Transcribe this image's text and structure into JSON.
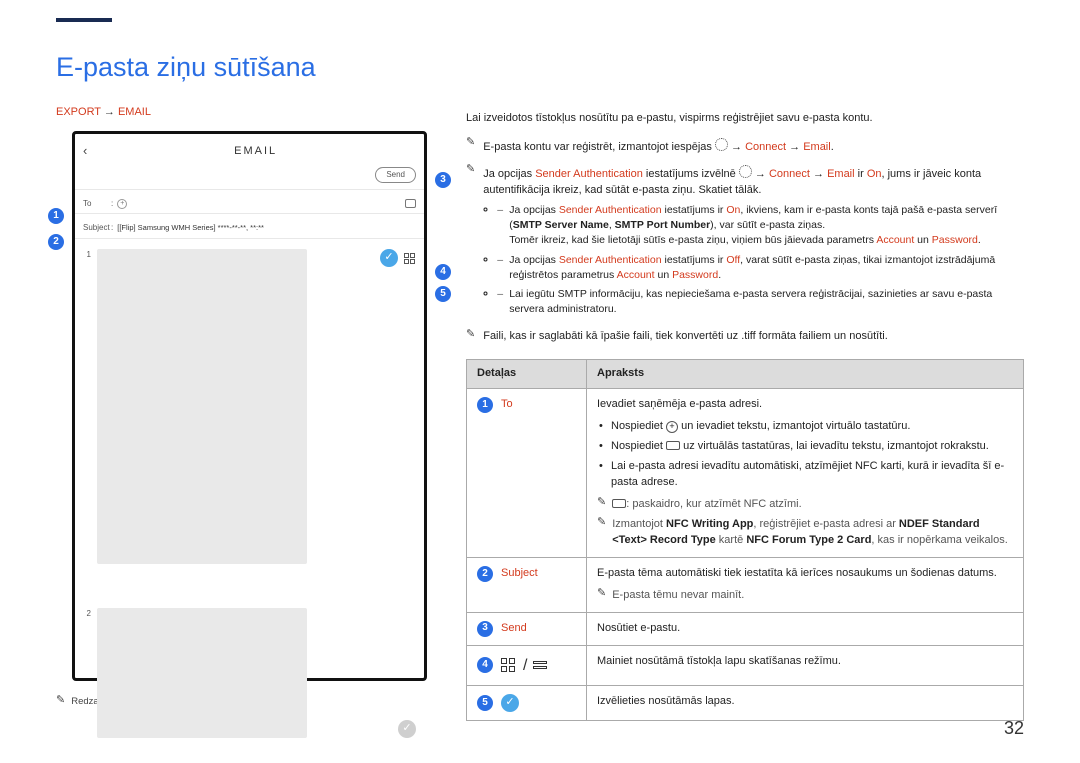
{
  "page_title": "E-pasta ziņu sūtīšana",
  "page_number": "32",
  "breadcrumb": {
    "a": "EXPORT",
    "arrow": "→",
    "b": "EMAIL"
  },
  "image_footnote": "Redzamais attēls var būt atšķirīgs atkarībā no modeļa.",
  "device": {
    "title": "EMAIL",
    "send": "Send",
    "to_label": "To",
    "plus": "+",
    "subject_label": "Subject",
    "subject_value": "[[Flip] Samsung WMH Series] ****-**-**, **:**",
    "page1": "1",
    "page2": "2"
  },
  "intro": "Lai izveidotos tīstokļus nosūtītu pa e-pastu, vispirms reģistrējiet savu e-pasta kontu.",
  "bul1_a": "E-pasta kontu var reģistrēt, izmantojot iespējas ",
  "bul1_b": " → ",
  "bul1_c": "Connect",
  "bul1_d": " → ",
  "bul1_e": "Email",
  "bul1_f": ".",
  "bul2_a": "Ja opcijas ",
  "bul2_b": "Sender Authentication",
  "bul2_c": " iestatījums izvēlnē ",
  "bul2_d": " → ",
  "bul2_e": "Connect",
  "bul2_f": " → ",
  "bul2_g": "Email",
  "bul2_h": " ir ",
  "bul2_i": "On",
  "bul2_j": ", jums ir jāveic konta autentifikācija ikreiz, kad sūtāt e-pasta ziņu. Skatiet tālāk.",
  "sub1_a": "Ja opcijas ",
  "sub1_b": "Sender Authentication",
  "sub1_c": " iestatījums ir ",
  "sub1_d": "On",
  "sub1_e": ", ikviens, kam ir e-pasta konts tajā pašā e-pasta serverī (",
  "sub1_f": "SMTP Server Name",
  "sub1_g": ", ",
  "sub1_h": "SMTP Port Number",
  "sub1_i": "), var sūtīt e-pasta ziņas.",
  "sub1_j": "Tomēr ikreiz, kad šie lietotāji sūtīs e-pasta ziņu, viņiem būs jāievada parametrs ",
  "sub1_k": "Account",
  "sub1_l": " un ",
  "sub1_m": "Password",
  "sub1_n": ".",
  "sub2_a": "Ja opcijas ",
  "sub2_b": "Sender Authentication",
  "sub2_c": " iestatījums ir ",
  "sub2_d": "Off",
  "sub2_e": ", varat sūtīt e-pasta ziņas, tikai izmantojot izstrādājumā reģistrētos parametrus ",
  "sub2_f": "Account",
  "sub2_g": " un ",
  "sub2_h": "Password",
  "sub2_i": ".",
  "sub3": "Lai iegūtu SMTP informāciju, kas nepieciešama e-pasta servera reģistrācijai, sazinieties ar savu e-pasta servera administratoru.",
  "bul3": "Faili, kas ir saglabāti kā īpašie faili, tiek konvertēti uz .tiff formāta failiem un nosūtīti.",
  "tbl_h1": "Detaļas",
  "tbl_h2": "Apraksts",
  "row1_label": "To",
  "row1_line1": "Ievadiet saņēmēja e-pasta adresi.",
  "row1_b1_a": "Nospiediet ",
  "row1_b1_b": " un ievadiet tekstu, izmantojot virtuālo tastatūru.",
  "row1_b2_a": "Nospiediet ",
  "row1_b2_b": " uz virtuālās tastatūras, lai ievadītu tekstu, izmantojot rokrakstu.",
  "row1_b3": "Lai e-pasta adresi ievadītu automātiski, atzīmējiet NFC karti, kurā ir ievadīta šī e-pasta adrese.",
  "row1_n1_a": ": paskaidro, kur atzīmēt NFC atzīmi.",
  "row1_n2_a": "Izmantojot ",
  "row1_n2_b": "NFC Writing App",
  "row1_n2_c": ", reģistrējiet e-pasta adresi ar ",
  "row1_n2_d": "NDEF Standard <Text> Record Type",
  "row1_n2_e": " kartē ",
  "row1_n2_f": "NFC Forum Type 2 Card",
  "row1_n2_g": ", kas ir nopērkama veikalos.",
  "row2_label": "Subject",
  "row2_line1": "E-pasta tēma automātiski tiek iestatīta kā ierīces nosaukums un šodienas datums.",
  "row2_note": "E-pasta tēmu nevar mainīt.",
  "row3_label": "Send",
  "row3_desc": "Nosūtiet e-pastu.",
  "row4_desc": "Mainiet nosūtāmā tīstokļa lapu skatīšanas režīmu.",
  "row5_desc": "Izvēlieties nosūtāmās lapas."
}
